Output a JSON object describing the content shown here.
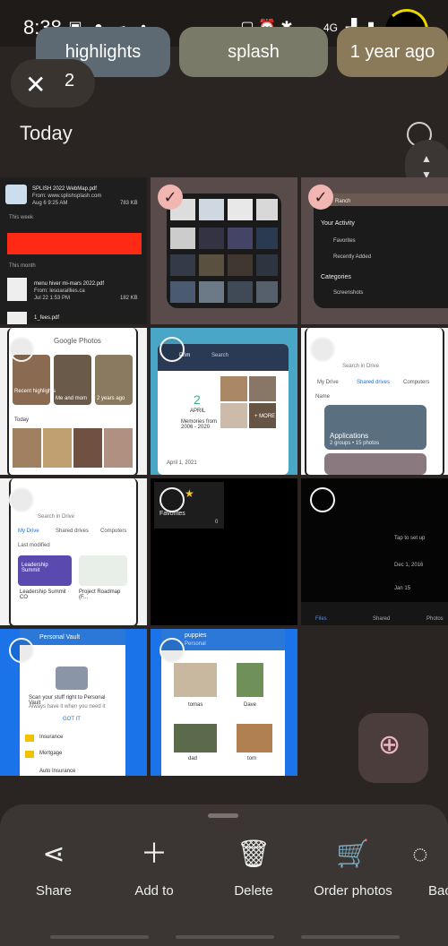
{
  "status": {
    "time": "8:38",
    "network": "4G"
  },
  "chips": [
    "highlights",
    "splash",
    "1 year ago"
  ],
  "selection": {
    "count": "2"
  },
  "section_title": "Today",
  "tiles": {
    "t1": {
      "file1": "SPLISH 2022 WebMap.pdf",
      "file1_src": "From: www.splishsplash.com",
      "file1_date": "Aug 6 9:25 AM",
      "file1_size": "783 KB",
      "this_week": "This week",
      "this_month": "This month",
      "file2": "menu hiver mi-mars 2022.pdf",
      "file2_src": "From: lesoaraillies.ca",
      "file2_date": "Jul 22 1:53 PM",
      "file2_size": "182 KB",
      "file3": "1_fees.pdf"
    },
    "t3": {
      "your_activity": "Your Activity",
      "favorites": "Favorites",
      "recently_added": "Recently Added",
      "categories": "Categories",
      "screenshots": "Screenshots",
      "ranch": "Ranch"
    },
    "t4": {
      "app": "Google Photos",
      "recent": "Recent highlights",
      "meandmom": "Me and mom",
      "twoyears": "2 years ago",
      "today": "Today"
    },
    "t5": {
      "app": "Prim",
      "search": "Search",
      "day": "2",
      "month": "APRIL",
      "memories": "Memories from 2006 - 2020",
      "more": "+ MORE",
      "date": "April 1, 2021"
    },
    "t6": {
      "search": "Search in Drive",
      "tab1": "My Drive",
      "tab2": "Shared drives",
      "tab3": "Computers",
      "name": "Name",
      "folder": "Applications",
      "groups": "2 groups • 15 photos"
    },
    "t7": {
      "search": "Search in Drive",
      "tab1": "My Drive",
      "tab2": "Shared drives",
      "tab3": "Computers",
      "modified": "Last modified",
      "doc1": "Leadership Summit",
      "doc1b": "Leadership Summit · CO",
      "doc2": "Project Roadmap (F..."
    },
    "t8": {
      "favorites": "Favorites",
      "count": "0"
    },
    "t9": {
      "tap": "Tap to set up",
      "date1": "Dec 1, 2016",
      "date2": "Jan 15",
      "nav1": "Files",
      "nav2": "Shared",
      "nav3": "Photos"
    },
    "t10": {
      "title": "Personal Vault",
      "scan": "Scan your stuff right to Personal Vault",
      "sub": "Always have it when you need it",
      "got": "GOT IT",
      "f1": "Insurance",
      "f2": "Mortgage",
      "f3": "Auto Insurance"
    },
    "t11": {
      "title": "puppies",
      "sub": "Personal",
      "p1": "tomas",
      "p2": "Dave",
      "p3": "dad",
      "p4": "tom"
    }
  },
  "actions": [
    {
      "label": "Share",
      "icon": "share-icon"
    },
    {
      "label": "Add to",
      "icon": "plus-icon"
    },
    {
      "label": "Delete",
      "icon": "trash-icon"
    },
    {
      "label": "Order photos",
      "icon": "cart-icon"
    },
    {
      "label": "Bac",
      "icon": "backup-icon"
    }
  ]
}
